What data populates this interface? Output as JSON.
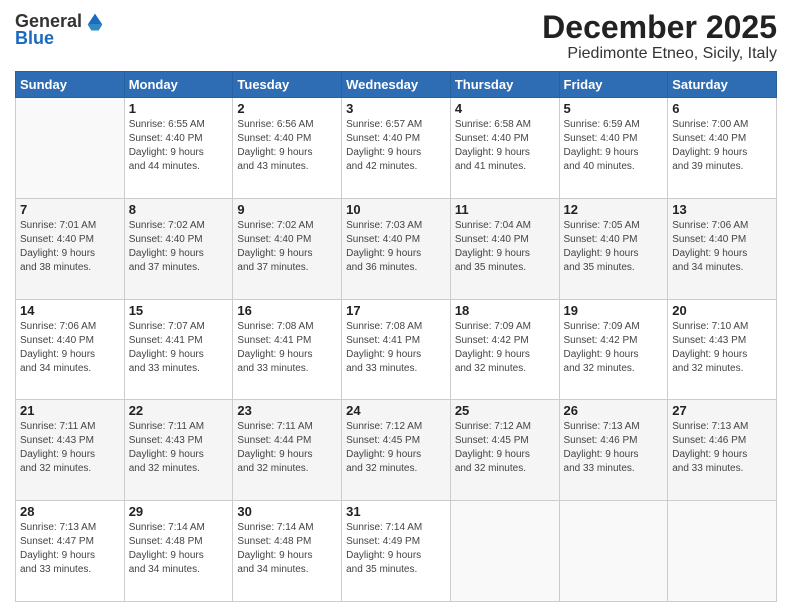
{
  "header": {
    "logo_line1": "General",
    "logo_line2": "Blue",
    "title": "December 2025",
    "subtitle": "Piedimonte Etneo, Sicily, Italy"
  },
  "days_of_week": [
    "Sunday",
    "Monday",
    "Tuesday",
    "Wednesday",
    "Thursday",
    "Friday",
    "Saturday"
  ],
  "weeks": [
    [
      {
        "day": "",
        "info": ""
      },
      {
        "day": "1",
        "info": "Sunrise: 6:55 AM\nSunset: 4:40 PM\nDaylight: 9 hours\nand 44 minutes."
      },
      {
        "day": "2",
        "info": "Sunrise: 6:56 AM\nSunset: 4:40 PM\nDaylight: 9 hours\nand 43 minutes."
      },
      {
        "day": "3",
        "info": "Sunrise: 6:57 AM\nSunset: 4:40 PM\nDaylight: 9 hours\nand 42 minutes."
      },
      {
        "day": "4",
        "info": "Sunrise: 6:58 AM\nSunset: 4:40 PM\nDaylight: 9 hours\nand 41 minutes."
      },
      {
        "day": "5",
        "info": "Sunrise: 6:59 AM\nSunset: 4:40 PM\nDaylight: 9 hours\nand 40 minutes."
      },
      {
        "day": "6",
        "info": "Sunrise: 7:00 AM\nSunset: 4:40 PM\nDaylight: 9 hours\nand 39 minutes."
      }
    ],
    [
      {
        "day": "7",
        "info": "Sunrise: 7:01 AM\nSunset: 4:40 PM\nDaylight: 9 hours\nand 38 minutes."
      },
      {
        "day": "8",
        "info": "Sunrise: 7:02 AM\nSunset: 4:40 PM\nDaylight: 9 hours\nand 37 minutes."
      },
      {
        "day": "9",
        "info": "Sunrise: 7:02 AM\nSunset: 4:40 PM\nDaylight: 9 hours\nand 37 minutes."
      },
      {
        "day": "10",
        "info": "Sunrise: 7:03 AM\nSunset: 4:40 PM\nDaylight: 9 hours\nand 36 minutes."
      },
      {
        "day": "11",
        "info": "Sunrise: 7:04 AM\nSunset: 4:40 PM\nDaylight: 9 hours\nand 35 minutes."
      },
      {
        "day": "12",
        "info": "Sunrise: 7:05 AM\nSunset: 4:40 PM\nDaylight: 9 hours\nand 35 minutes."
      },
      {
        "day": "13",
        "info": "Sunrise: 7:06 AM\nSunset: 4:40 PM\nDaylight: 9 hours\nand 34 minutes."
      }
    ],
    [
      {
        "day": "14",
        "info": "Sunrise: 7:06 AM\nSunset: 4:40 PM\nDaylight: 9 hours\nand 34 minutes."
      },
      {
        "day": "15",
        "info": "Sunrise: 7:07 AM\nSunset: 4:41 PM\nDaylight: 9 hours\nand 33 minutes."
      },
      {
        "day": "16",
        "info": "Sunrise: 7:08 AM\nSunset: 4:41 PM\nDaylight: 9 hours\nand 33 minutes."
      },
      {
        "day": "17",
        "info": "Sunrise: 7:08 AM\nSunset: 4:41 PM\nDaylight: 9 hours\nand 33 minutes."
      },
      {
        "day": "18",
        "info": "Sunrise: 7:09 AM\nSunset: 4:42 PM\nDaylight: 9 hours\nand 32 minutes."
      },
      {
        "day": "19",
        "info": "Sunrise: 7:09 AM\nSunset: 4:42 PM\nDaylight: 9 hours\nand 32 minutes."
      },
      {
        "day": "20",
        "info": "Sunrise: 7:10 AM\nSunset: 4:43 PM\nDaylight: 9 hours\nand 32 minutes."
      }
    ],
    [
      {
        "day": "21",
        "info": "Sunrise: 7:11 AM\nSunset: 4:43 PM\nDaylight: 9 hours\nand 32 minutes."
      },
      {
        "day": "22",
        "info": "Sunrise: 7:11 AM\nSunset: 4:43 PM\nDaylight: 9 hours\nand 32 minutes."
      },
      {
        "day": "23",
        "info": "Sunrise: 7:11 AM\nSunset: 4:44 PM\nDaylight: 9 hours\nand 32 minutes."
      },
      {
        "day": "24",
        "info": "Sunrise: 7:12 AM\nSunset: 4:45 PM\nDaylight: 9 hours\nand 32 minutes."
      },
      {
        "day": "25",
        "info": "Sunrise: 7:12 AM\nSunset: 4:45 PM\nDaylight: 9 hours\nand 32 minutes."
      },
      {
        "day": "26",
        "info": "Sunrise: 7:13 AM\nSunset: 4:46 PM\nDaylight: 9 hours\nand 33 minutes."
      },
      {
        "day": "27",
        "info": "Sunrise: 7:13 AM\nSunset: 4:46 PM\nDaylight: 9 hours\nand 33 minutes."
      }
    ],
    [
      {
        "day": "28",
        "info": "Sunrise: 7:13 AM\nSunset: 4:47 PM\nDaylight: 9 hours\nand 33 minutes."
      },
      {
        "day": "29",
        "info": "Sunrise: 7:14 AM\nSunset: 4:48 PM\nDaylight: 9 hours\nand 34 minutes."
      },
      {
        "day": "30",
        "info": "Sunrise: 7:14 AM\nSunset: 4:48 PM\nDaylight: 9 hours\nand 34 minutes."
      },
      {
        "day": "31",
        "info": "Sunrise: 7:14 AM\nSunset: 4:49 PM\nDaylight: 9 hours\nand 35 minutes."
      },
      {
        "day": "",
        "info": ""
      },
      {
        "day": "",
        "info": ""
      },
      {
        "day": "",
        "info": ""
      }
    ]
  ]
}
